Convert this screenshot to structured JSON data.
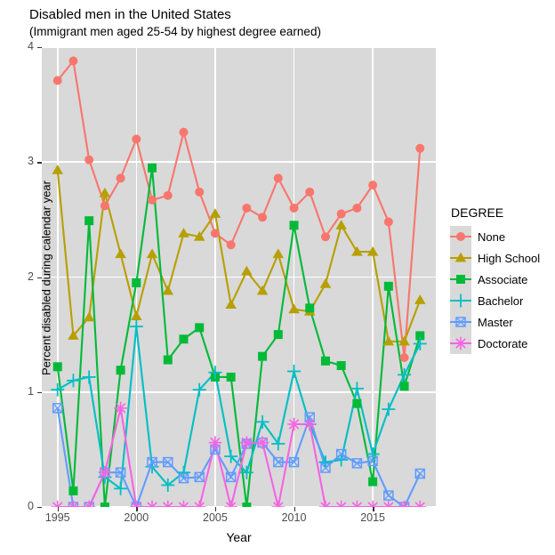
{
  "chart_data": {
    "type": "line",
    "title": "Disabled men in the United States",
    "subtitle": "(Immigrant men aged 25-54 by highest degree earned)",
    "xlabel": "Year",
    "ylabel": "Percent disabled during calendar year",
    "legend_title": "DEGREE",
    "legend_position": "right",
    "grid": true,
    "xlim": [
      1994,
      2019
    ],
    "ylim": [
      0,
      4
    ],
    "xticks": [
      1995,
      2000,
      2005,
      2010,
      2015
    ],
    "yticks": [
      0,
      1,
      2,
      3,
      4
    ],
    "x": [
      1995,
      1996,
      1997,
      1998,
      1999,
      2000,
      2001,
      2002,
      2003,
      2004,
      2005,
      2006,
      2007,
      2008,
      2009,
      2010,
      2011,
      2012,
      2013,
      2014,
      2015,
      2016,
      2017,
      2018
    ],
    "series": [
      {
        "name": "None",
        "color": "#F8766D",
        "marker": "circle",
        "values": [
          3.71,
          3.88,
          3.02,
          2.62,
          2.86,
          3.2,
          2.67,
          2.71,
          3.26,
          2.74,
          2.38,
          2.28,
          2.6,
          2.52,
          2.86,
          2.6,
          2.74,
          2.35,
          2.55,
          2.6,
          2.8,
          2.48,
          1.3,
          3.12
        ]
      },
      {
        "name": "High School",
        "color": "#B79F00",
        "marker": "triangle",
        "values": [
          2.93,
          1.49,
          1.65,
          2.73,
          2.2,
          1.66,
          2.2,
          1.88,
          2.38,
          2.35,
          2.55,
          1.76,
          2.05,
          1.88,
          2.2,
          1.72,
          1.7,
          1.94,
          2.45,
          2.22,
          2.22,
          1.44,
          1.44,
          1.8
        ]
      },
      {
        "name": "Associate",
        "color": "#00BA38",
        "marker": "square",
        "values": [
          1.22,
          0.14,
          2.49,
          0.0,
          1.19,
          1.95,
          2.95,
          1.28,
          1.46,
          1.56,
          1.13,
          1.13,
          0.0,
          1.31,
          1.5,
          2.45,
          1.73,
          1.27,
          1.23,
          0.9,
          0.22,
          1.92,
          1.05,
          1.49
        ]
      },
      {
        "name": "Bachelor",
        "color": "#00BFC4",
        "marker": "plus",
        "values": [
          1.02,
          1.1,
          1.13,
          0.26,
          0.16,
          1.57,
          0.35,
          0.19,
          0.3,
          1.02,
          1.17,
          0.44,
          0.3,
          0.74,
          0.55,
          1.18,
          0.72,
          0.39,
          0.41,
          1.03,
          0.46,
          0.85,
          1.15,
          1.42
        ]
      },
      {
        "name": "Master",
        "color": "#619CFF",
        "marker": "square-x",
        "values": [
          0.86,
          0.0,
          0.0,
          0.3,
          0.3,
          0.0,
          0.39,
          0.39,
          0.25,
          0.26,
          0.5,
          0.26,
          0.55,
          0.56,
          0.39,
          0.39,
          0.78,
          0.34,
          0.46,
          0.38,
          0.4,
          0.1,
          0.0,
          0.29
        ]
      },
      {
        "name": "Doctorate",
        "color": "#F564E3",
        "marker": "asterisk",
        "values": [
          0.0,
          0.0,
          0.0,
          0.3,
          0.86,
          0.0,
          0.0,
          0.0,
          0.0,
          0.0,
          0.56,
          0.0,
          0.56,
          0.56,
          0.0,
          0.72,
          0.72,
          0.0,
          0.0,
          0.0,
          0.0,
          0.0,
          0.0,
          0.0
        ]
      }
    ]
  }
}
